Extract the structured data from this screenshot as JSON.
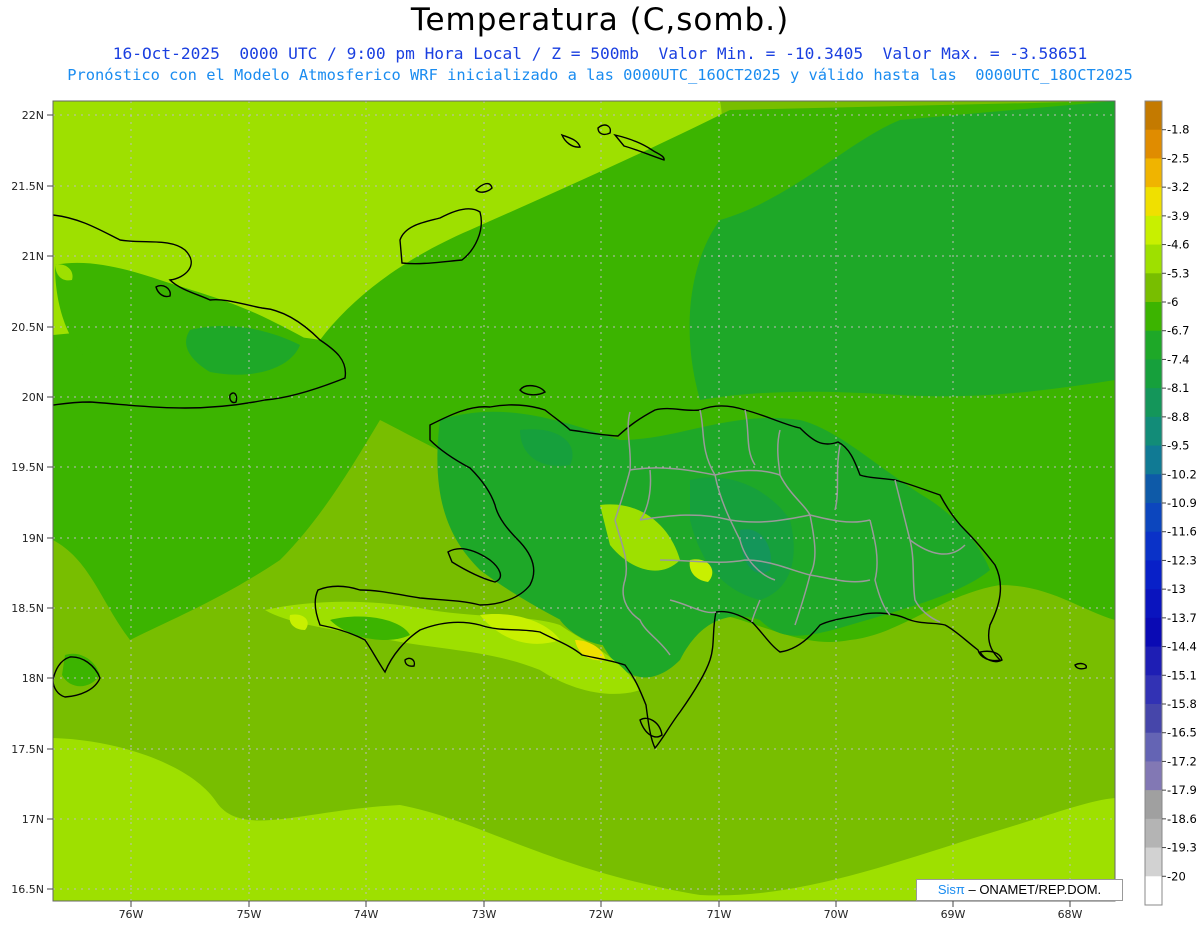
{
  "header": {
    "title": "Temperatura (C,somb.)",
    "line1": "16-Oct-2025  0000 UTC / 9:00 pm Hora Local / Z = 500mb  Valor Min. = -10.3405  Valor Max. = -3.58651",
    "line2": "Pronóstico con el Modelo Atmosferico WRF inicializado a las 0000UTC_16OCT2025 y válido hasta las  0000UTC_18OCT2025"
  },
  "axes": {
    "lat_labels": [
      "22N",
      "21.5N",
      "21N",
      "20.5N",
      "20N",
      "19.5N",
      "19N",
      "18.5N",
      "18N",
      "17.5N",
      "17N",
      "16.5N"
    ],
    "lon_labels": [
      "76W",
      "75W",
      "74W",
      "73W",
      "72W",
      "71W",
      "70W",
      "69W",
      "68W"
    ]
  },
  "colorbar": {
    "labels": [
      "-1.8",
      "-2.5",
      "-3.2",
      "-3.9",
      "-4.6",
      "-5.3",
      "-6",
      "-6.7",
      "-7.4",
      "-8.1",
      "-8.8",
      "-9.5",
      "-10.2",
      "-10.9",
      "-11.6",
      "-12.3",
      "-13",
      "-13.7",
      "-14.4",
      "-15.1",
      "-15.8",
      "-16.5",
      "-17.2",
      "-17.9",
      "-18.6",
      "-19.3",
      "-20"
    ],
    "colors": [
      "#c47a00",
      "#e08c00",
      "#f0b400",
      "#f0e000",
      "#c8f000",
      "#9ee000",
      "#78be00",
      "#3cb400",
      "#1ea828",
      "#16a03c",
      "#14965a",
      "#128c78",
      "#107a94",
      "#0e5aa8",
      "#0c46be",
      "#0a32c8",
      "#0820c8",
      "#0a14be",
      "#0a0ab4",
      "#1e1eb4",
      "#3232b4",
      "#4646aa",
      "#6464b4",
      "#8278b4",
      "#a0a0a0",
      "#b4b4b4",
      "#d2d2d2",
      "#ffffff"
    ]
  },
  "credit": {
    "brand": "Sisπ",
    "text": " – ONAMET/REP.DOM."
  }
}
